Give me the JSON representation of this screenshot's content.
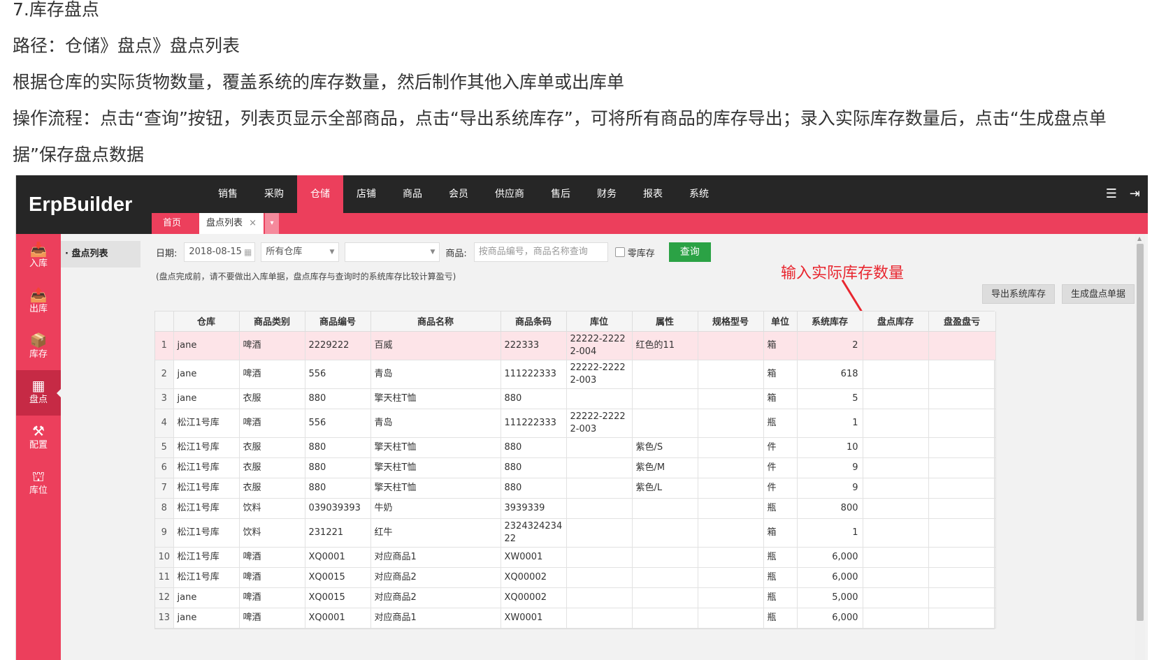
{
  "doc": {
    "heading": "7.库存盘点",
    "path": "路径：仓储》盘点》盘点列表",
    "desc": "根据仓库的实际货物数量，覆盖系统的库存数量，然后制作其他入库单或出库单",
    "flow": "操作流程：点击“查询”按钮，列表页显示全部商品，点击“导出系统库存”，可将所有商品的库存导出；录入实际库存数量后，点击“生成盘点单据”保存盘点数据"
  },
  "app": {
    "logo": "ErpBuilder",
    "nav": [
      "销售",
      "采购",
      "仓储",
      "店铺",
      "商品",
      "会员",
      "供应商",
      "售后",
      "财务",
      "报表",
      "系统"
    ],
    "nav_active": "仓储",
    "icons": {
      "menu": "menu-icon",
      "logout": "logout-icon"
    }
  },
  "tabs": {
    "home": "首页",
    "current": "盘点列表",
    "close": "×",
    "more": "▾"
  },
  "sidebar": [
    {
      "label": "入库",
      "icon": "inbound-icon",
      "glyph": "📥"
    },
    {
      "label": "出库",
      "icon": "outbound-icon",
      "glyph": "📤"
    },
    {
      "label": "库存",
      "icon": "stock-icon",
      "glyph": "📦"
    },
    {
      "label": "盘点",
      "icon": "inventory-check-icon",
      "glyph": "▦",
      "active": true
    },
    {
      "label": "配置",
      "icon": "config-icon",
      "glyph": "⚒"
    },
    {
      "label": "库位",
      "icon": "location-icon",
      "glyph": "⛫"
    }
  ],
  "subnav": {
    "item": "· 盘点列表"
  },
  "filter": {
    "date_label": "日期:",
    "date_value": "2018-08-15",
    "warehouse_value": "所有仓库",
    "select2_value": "",
    "product_label": "商品:",
    "product_placeholder": "按商品编号，商品名称查询",
    "zero_stock_label": "零库存",
    "query_label": "查询"
  },
  "notice": "(盘点完成前，请不要做出入库单据，盘点库存与查询时的系统库存比较计算盈亏)",
  "annotation": "输入实际库存数量",
  "actions": {
    "export": "导出系统库存",
    "generate": "生成盘点单据"
  },
  "colors": {
    "accent": "#ec3f5c",
    "dark": "#262626",
    "query": "#2ba245",
    "annotation": "#e8262f"
  },
  "table": {
    "headers": [
      "",
      "仓库",
      "商品类别",
      "商品编号",
      "商品名称",
      "商品条码",
      "库位",
      "属性",
      "规格型号",
      "单位",
      "系统库存",
      "盘点库存",
      "盘盈盘亏"
    ],
    "rows": [
      [
        "1",
        "jane",
        "啤酒",
        "2229222",
        "百威",
        "222333",
        "22222-22222-004",
        "红色的11",
        "",
        "箱",
        "2",
        "",
        ""
      ],
      [
        "2",
        "jane",
        "啤酒",
        "556",
        "青岛",
        "111222333",
        "22222-22222-003",
        "",
        "",
        "箱",
        "618",
        "",
        ""
      ],
      [
        "3",
        "jane",
        "衣服",
        "880",
        "擎天柱T恤",
        "880",
        "",
        "",
        "",
        "箱",
        "5",
        "",
        ""
      ],
      [
        "4",
        "松江1号库",
        "啤酒",
        "556",
        "青岛",
        "111222333",
        "22222-22222-003",
        "",
        "",
        "瓶",
        "1",
        "",
        ""
      ],
      [
        "5",
        "松江1号库",
        "衣服",
        "880",
        "擎天柱T恤",
        "880",
        "",
        "紫色/S",
        "",
        "件",
        "10",
        "",
        ""
      ],
      [
        "6",
        "松江1号库",
        "衣服",
        "880",
        "擎天柱T恤",
        "880",
        "",
        "紫色/M",
        "",
        "件",
        "9",
        "",
        ""
      ],
      [
        "7",
        "松江1号库",
        "衣服",
        "880",
        "擎天柱T恤",
        "880",
        "",
        "紫色/L",
        "",
        "件",
        "9",
        "",
        ""
      ],
      [
        "8",
        "松江1号库",
        "饮料",
        "039039393",
        "牛奶",
        "3939339",
        "",
        "",
        "",
        "瓶",
        "800",
        "",
        ""
      ],
      [
        "9",
        "松江1号库",
        "饮料",
        "231221",
        "红牛",
        "232432423422",
        "",
        "",
        "",
        "箱",
        "1",
        "",
        ""
      ],
      [
        "10",
        "松江1号库",
        "啤酒",
        "XQ0001",
        "对应商品1",
        "XW0001",
        "",
        "",
        "",
        "瓶",
        "6,000",
        "",
        ""
      ],
      [
        "11",
        "松江1号库",
        "啤酒",
        "XQ0015",
        "对应商品2",
        "XQ00002",
        "",
        "",
        "",
        "瓶",
        "6,000",
        "",
        ""
      ],
      [
        "12",
        "jane",
        "啤酒",
        "XQ0015",
        "对应商品2",
        "XQ00002",
        "",
        "",
        "",
        "瓶",
        "5,000",
        "",
        ""
      ],
      [
        "13",
        "jane",
        "啤酒",
        "XQ0001",
        "对应商品1",
        "XW0001",
        "",
        "",
        "",
        "瓶",
        "6,000",
        "",
        ""
      ]
    ],
    "selected_row": 0
  }
}
